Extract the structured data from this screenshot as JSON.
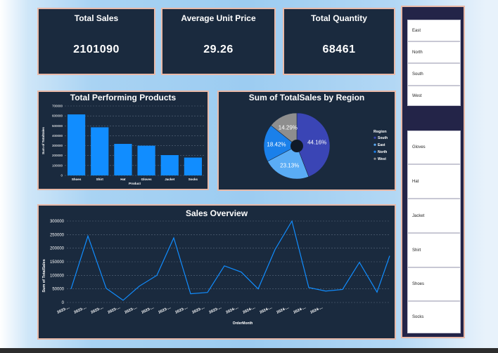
{
  "kpis": [
    {
      "title": "Total Sales",
      "value": "2101090"
    },
    {
      "title": "Average Unit Price",
      "value": "29.26"
    },
    {
      "title": "Total Quantity",
      "value": "68461"
    }
  ],
  "bar_panel": {
    "title": "Total Performing Products"
  },
  "pie_panel": {
    "title": "Sum of TotalSales by Region"
  },
  "line_panel": {
    "title": "Sales Overview"
  },
  "chart_data": [
    {
      "type": "bar",
      "title": "Total Performing Products",
      "xlabel": "Product",
      "ylabel": "Sum of TotalSales",
      "categories": [
        "Shoes",
        "Shirt",
        "Hat",
        "Gloves",
        "Jacket",
        "Socks"
      ],
      "values": [
        615000,
        485000,
        318000,
        300000,
        205000,
        180000
      ],
      "ylim": [
        0,
        700000
      ],
      "yticks": [
        "0",
        "100000",
        "200000",
        "300000",
        "400000",
        "500000",
        "600000",
        "700000"
      ],
      "grid": true,
      "color": "#118dff"
    },
    {
      "type": "pie",
      "title": "Sum of TotalSales by Region",
      "legend_title": "Region",
      "legend_position": "right",
      "slices": [
        {
          "name": "South",
          "percent": 44.16,
          "label": "44.16%",
          "color": "#3a45b5"
        },
        {
          "name": "East",
          "percent": 23.13,
          "label": "23.13%",
          "color": "#5aacf5"
        },
        {
          "name": "North",
          "percent": 18.42,
          "label": "18.42%",
          "color": "#1a80ea"
        },
        {
          "name": "West",
          "percent": 14.29,
          "label": "14.29%",
          "color": "#8e8e8e"
        }
      ]
    },
    {
      "type": "line",
      "title": "Sales Overview",
      "xlabel": "OrderMonth",
      "ylabel": "Sum of TotalSales",
      "ylim": [
        0,
        300000
      ],
      "yticks": [
        "0",
        "50000",
        "100000",
        "150000",
        "200000",
        "250000",
        "300000"
      ],
      "x_tick_labels": [
        "2023-...",
        "2023-...",
        "2023-...",
        "2023-...",
        "2023-...",
        "2023-...",
        "2023-...",
        "2023-...",
        "2023-...",
        "2023-...",
        "2024-...",
        "2024-...",
        "2024-...",
        "2024-...",
        "2024-...",
        "2024-..."
      ],
      "values": [
        50000,
        245000,
        52000,
        8000,
        60000,
        100000,
        238000,
        32000,
        37000,
        135000,
        112000,
        50000,
        195000,
        300000,
        55000,
        42000,
        48000,
        148000,
        38000,
        172000
      ],
      "grid": true,
      "color": "#118dff"
    }
  ],
  "slicers": {
    "regions": [
      "East",
      "North",
      "South",
      "West"
    ],
    "products": [
      "Gloves",
      "Hat",
      "Jacket",
      "Shirt",
      "Shoes",
      "Socks"
    ]
  }
}
